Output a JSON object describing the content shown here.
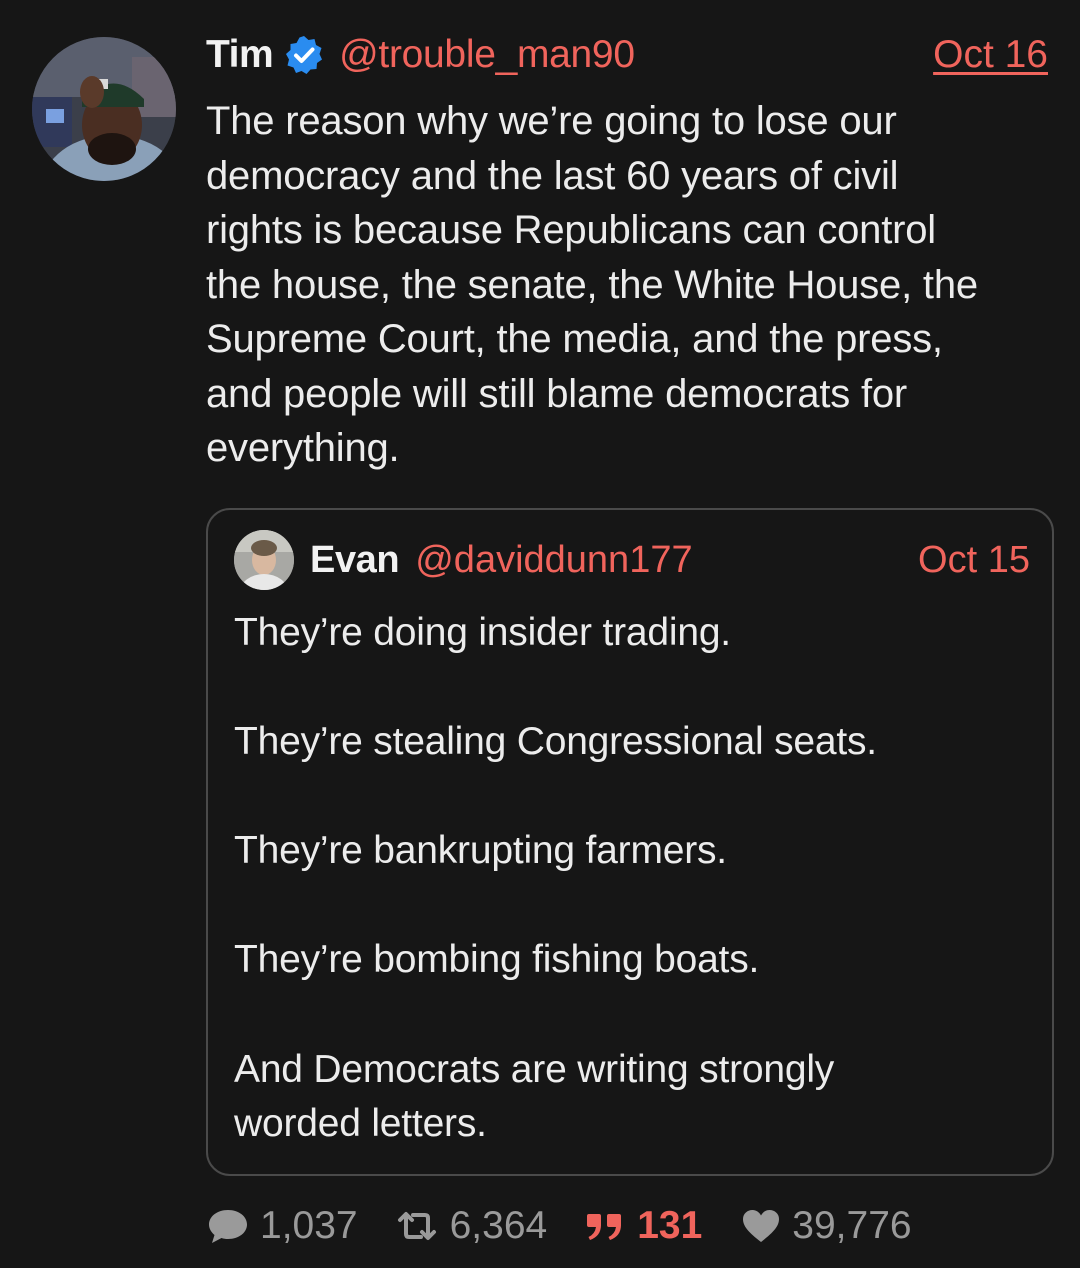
{
  "post": {
    "author_name": "Tim",
    "author_handle": "@trouble_man90",
    "date": "Oct 16",
    "text": "The reason why we’re going to lose our\ndemocracy and the last 60 years of civil\nrights is because Republicans can control\nthe house, the senate, the White House, the\nSupreme Court, the media, and the press,\nand people will still blame democrats for\neverything.",
    "verified_icon": "verified-check-icon"
  },
  "quoted": {
    "author_name": "Evan",
    "author_handle": "@daviddunn177",
    "date": "Oct 15",
    "lines": [
      "They’re doing insider trading.",
      "They’re stealing Congressional seats.",
      "They’re bankrupting farmers.",
      "They’re bombing fishing boats.",
      "And Democrats are writing strongly",
      "worded letters."
    ]
  },
  "actions": {
    "replies": "1,037",
    "reposts": "6,364",
    "quotes": "131",
    "likes": "39,776"
  },
  "colors": {
    "background": "#161616",
    "accent": "#f0645c",
    "verified": "#2a8cf0",
    "muted": "#9a9a9a",
    "text": "#ececec"
  }
}
